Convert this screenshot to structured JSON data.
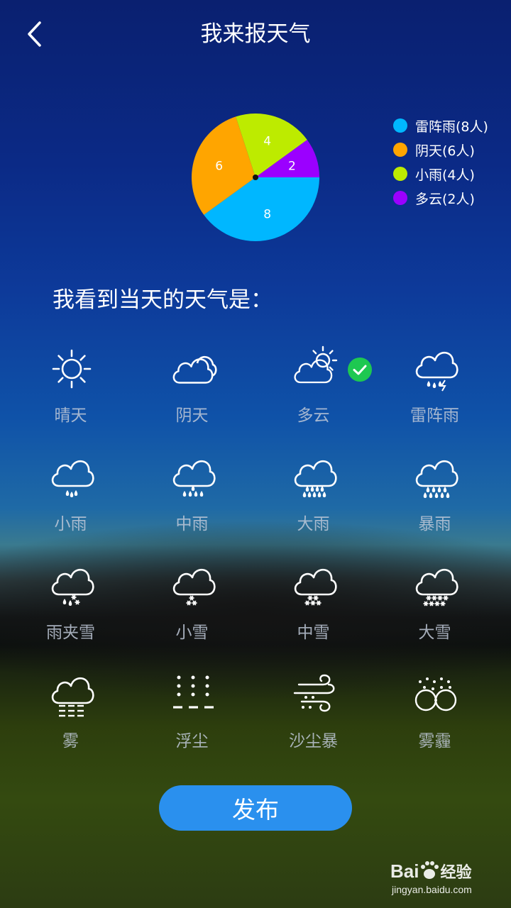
{
  "header": {
    "title": "我来报天气",
    "back_icon": "chevron-left-icon"
  },
  "chart_data": {
    "type": "pie",
    "slices": [
      {
        "label": "雷阵雨(8人)",
        "value": 8,
        "color": "#00b7ff"
      },
      {
        "label": "阴天(6人)",
        "value": 6,
        "color": "#ffa500"
      },
      {
        "label": "小雨(4人)",
        "value": 4,
        "color": "#bdeb00"
      },
      {
        "label": "多云(2人)",
        "value": 2,
        "color": "#9b00ff"
      }
    ]
  },
  "prompt": "我看到当天的天气是：",
  "weather_options": [
    {
      "label": "晴天",
      "icon": "sun-icon"
    },
    {
      "label": "阴天",
      "icon": "overcast-icon"
    },
    {
      "label": "多云",
      "icon": "partly-cloudy-icon",
      "selected": true
    },
    {
      "label": "雷阵雨",
      "icon": "thunder-shower-icon"
    },
    {
      "label": "小雨",
      "icon": "light-rain-icon"
    },
    {
      "label": "中雨",
      "icon": "moderate-rain-icon"
    },
    {
      "label": "大雨",
      "icon": "heavy-rain-icon"
    },
    {
      "label": "暴雨",
      "icon": "rainstorm-icon"
    },
    {
      "label": "雨夹雪",
      "icon": "sleet-icon"
    },
    {
      "label": "小雪",
      "icon": "light-snow-icon"
    },
    {
      "label": "中雪",
      "icon": "moderate-snow-icon"
    },
    {
      "label": "大雪",
      "icon": "heavy-snow-icon"
    },
    {
      "label": "雾",
      "icon": "fog-icon"
    },
    {
      "label": "浮尘",
      "icon": "floating-dust-icon"
    },
    {
      "label": "沙尘暴",
      "icon": "sandstorm-icon"
    },
    {
      "label": "雾霾",
      "icon": "haze-icon"
    }
  ],
  "publish_label": "发布",
  "watermark": {
    "brand": "Bai",
    "brand_suffix": "经验",
    "url": "jingyan.baidu.com"
  }
}
